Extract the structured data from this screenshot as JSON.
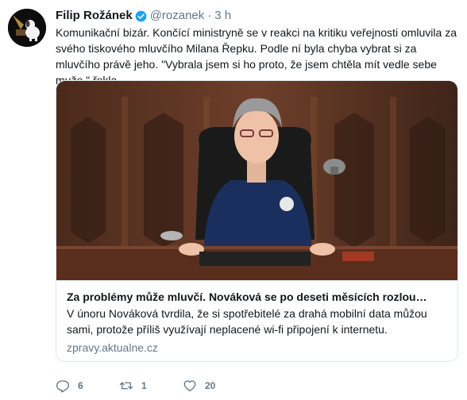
{
  "tweet": {
    "author": {
      "name": "Filip Rožánek",
      "handle": "@rozanek",
      "verified": true,
      "avatar_icon": "dog-gramophone-avatar"
    },
    "separator": "·",
    "time": "3 h",
    "text": "Komunikační bizár. Končící ministryně se v reakci na kritiku veřejnosti omluvila za svého tiskového mluvčího Milana Řepku. Podle ní byla chyba vybrat si za mluvčího právě jeho. \"Vybrala jsem si ho proto, že jsem chtěla mít vedle sebe muže,\" řekla.",
    "card": {
      "image_icon": "photo-woman-at-desk",
      "title": "Za problémy může mluvčí. Nováková se po deseti měsících rozlou…",
      "description": "V únoru Nováková tvrdila, že si spotřebitelé za drahá mobilní data můžou sami, protože příliš využívají neplacené wi-fi připojení k internetu.",
      "domain": "zpravy.aktualne.cz"
    },
    "actions": {
      "reply_count": "6",
      "retweet_count": "1",
      "like_count": "20",
      "reply_icon": "reply-icon",
      "retweet_icon": "retweet-icon",
      "like_icon": "heart-icon"
    }
  },
  "colors": {
    "text": "#14171a",
    "secondary": "#657786",
    "border": "#e1e8ed",
    "verified": "#1da1f2"
  }
}
